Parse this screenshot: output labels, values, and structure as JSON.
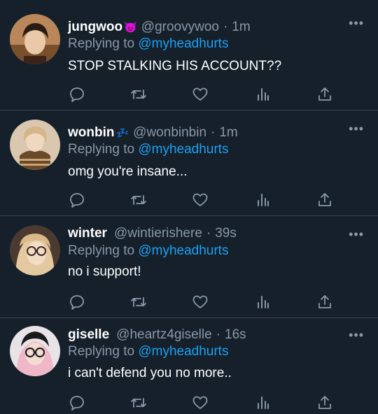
{
  "replies": [
    {
      "name": "jungwoo",
      "badge": "😈",
      "handle": "@groovywoo",
      "sep": "·",
      "time": "1m",
      "replying_prefix": "Replying to",
      "replying_to": "@myheadhurts",
      "text": "STOP STALKING HIS ACCOUNT??",
      "badge_color": "#a855f7"
    },
    {
      "name": "wonbin",
      "badge": "💤",
      "handle": "@wonbinbin",
      "sep": "·",
      "time": "1m",
      "replying_prefix": "Replying to",
      "replying_to": "@myheadhurts",
      "text": "omg you're insane...",
      "badge_color": "#1da1f2"
    },
    {
      "name": "winter",
      "badge": "",
      "handle": "@wintierishere",
      "sep": "·",
      "time": "39s",
      "replying_prefix": "Replying to",
      "replying_to": "@myheadhurts",
      "text": "no i support!",
      "badge_color": ""
    },
    {
      "name": "giselle",
      "badge": "",
      "handle": "@heartz4giselle",
      "sep": "·",
      "time": "16s",
      "replying_prefix": "Replying to",
      "replying_to": "@myheadhurts",
      "text": "i can't defend you no more..",
      "badge_color": ""
    }
  ],
  "icons": {
    "more": "more-icon",
    "reply": "reply-icon",
    "retweet": "retweet-icon",
    "like": "heart-icon",
    "analytics": "analytics-icon",
    "share": "share-icon"
  },
  "colors": {
    "background": "#15202b",
    "divider": "#38444d",
    "secondary_text": "#8899a6",
    "link": "#1da1f2",
    "primary_text": "#ffffff"
  }
}
